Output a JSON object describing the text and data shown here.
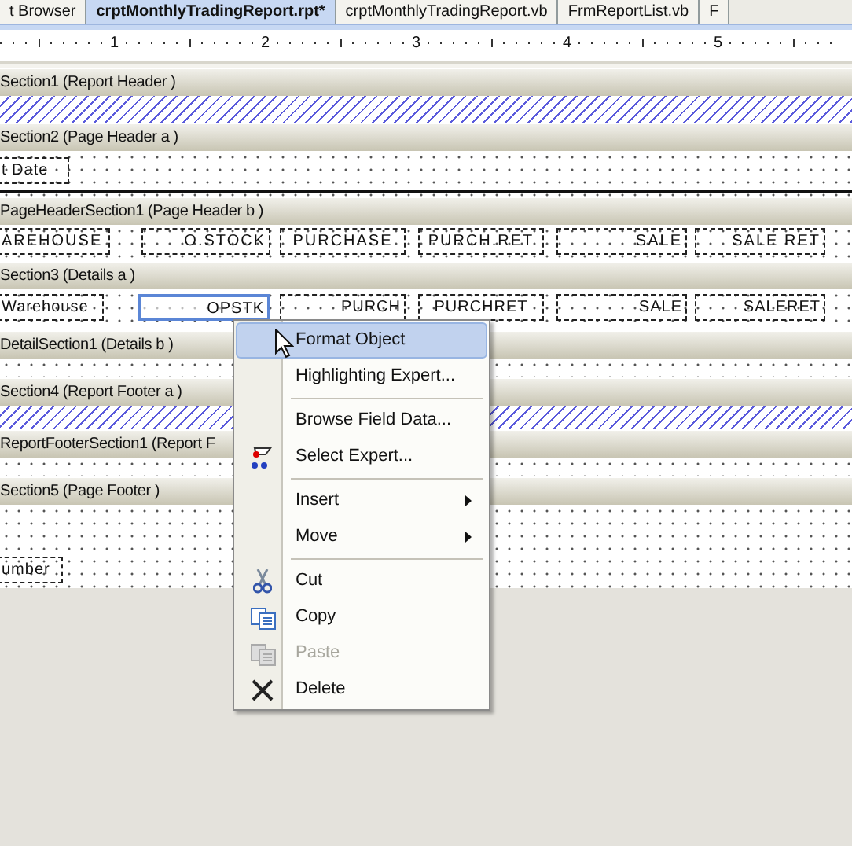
{
  "tabs": [
    {
      "label": "t Browser",
      "selected": false
    },
    {
      "label": "crptMonthlyTradingReport.rpt*",
      "selected": true
    },
    {
      "label": "crptMonthlyTradingReport.vb",
      "selected": false
    },
    {
      "label": "FrmReportList.vb",
      "selected": false
    },
    {
      "label": "F",
      "selected": false
    }
  ],
  "ruler": {
    "labels": [
      "1",
      "2",
      "3",
      "4",
      "5"
    ]
  },
  "sections": [
    {
      "title": "Section1 (Report Header  )",
      "body": {
        "kind": "hatched"
      }
    },
    {
      "title": "Section2 (Page Header a )",
      "body": {
        "kind": "canvas",
        "fields": [
          {
            "text": "t Date",
            "selected": false
          }
        ]
      }
    },
    {
      "title": "PageHeaderSection1 (Page Header b )",
      "body": {
        "kind": "canvas",
        "fields": [
          {
            "text": "AREHOUSE",
            "selected": false
          },
          {
            "text": "O.STOCK",
            "selected": false
          },
          {
            "text": "PURCHASE",
            "selected": false
          },
          {
            "text": "PURCH.RET",
            "selected": false
          },
          {
            "text": "SALE",
            "selected": false
          },
          {
            "text": "SALE RET",
            "selected": false
          }
        ]
      }
    },
    {
      "title": "Section3 (Details a )",
      "body": {
        "kind": "canvas",
        "fields": [
          {
            "text": "Warehouse",
            "selected": false
          },
          {
            "text": "OPSTK",
            "selected": true
          },
          {
            "text": "PURCH",
            "selected": false
          },
          {
            "text": "PURCHRET",
            "selected": false
          },
          {
            "text": "SALE",
            "selected": false
          },
          {
            "text": "SALERET",
            "selected": false
          }
        ]
      }
    },
    {
      "title": "DetailSection1 (Details b )",
      "body": {
        "kind": "canvas"
      }
    },
    {
      "title": "Section4 (Report Footer a )",
      "body": {
        "kind": "hatched"
      }
    },
    {
      "title": "ReportFooterSection1 (Report F",
      "body": {
        "kind": "canvas"
      }
    },
    {
      "title": "Section5 (Page Footer  )",
      "body": {
        "kind": "canvas",
        "fields": [
          {
            "text": "umber",
            "selected": false
          }
        ]
      }
    }
  ],
  "context_menu": {
    "items": [
      {
        "kind": "item",
        "label": "Format Object",
        "selected": true,
        "disabled": false
      },
      {
        "kind": "item",
        "label": "Highlighting Expert...",
        "selected": false,
        "disabled": false
      },
      {
        "kind": "separator"
      },
      {
        "kind": "item",
        "label": "Browse Field Data...",
        "selected": false,
        "disabled": false
      },
      {
        "kind": "item",
        "label": "Select Expert...",
        "selected": false,
        "disabled": false
      },
      {
        "kind": "separator"
      },
      {
        "kind": "submenu",
        "label": "Insert",
        "selected": false,
        "disabled": false
      },
      {
        "kind": "submenu",
        "label": "Move",
        "selected": false,
        "disabled": false
      },
      {
        "kind": "separator"
      },
      {
        "kind": "item",
        "label": "Cut",
        "selected": false,
        "disabled": false
      },
      {
        "kind": "item",
        "label": "Copy",
        "selected": false,
        "disabled": false
      },
      {
        "kind": "item",
        "label": "Paste",
        "selected": false,
        "disabled": true
      },
      {
        "kind": "item",
        "label": "Delete",
        "selected": false,
        "disabled": false
      }
    ]
  }
}
